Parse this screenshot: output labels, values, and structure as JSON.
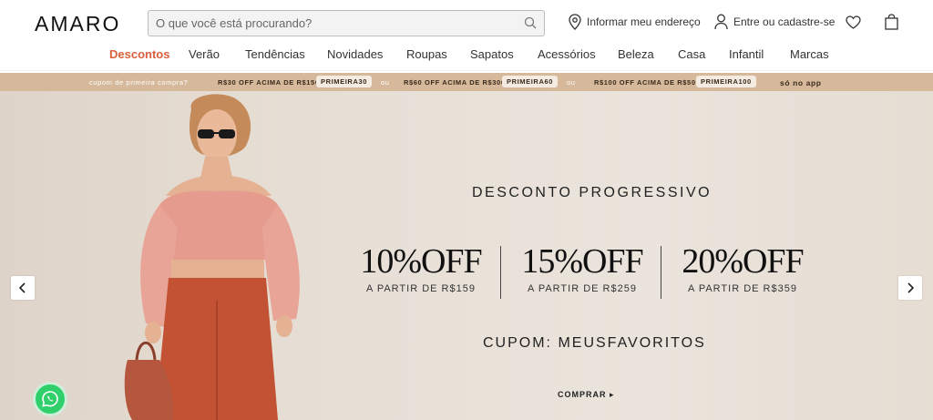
{
  "header": {
    "logo": "AMARO",
    "search_placeholder": "O que você está procurando?",
    "address_link": "Informar meu endereço",
    "account_link": "Entre ou cadastre-se"
  },
  "nav": {
    "items": [
      "Descontos",
      "Verão",
      "Tendências",
      "Novidades",
      "Roupas",
      "Sapatos",
      "Acessórios",
      "Beleza",
      "Casa",
      "Infantil",
      "Marcas"
    ],
    "active_color": "#d9603b"
  },
  "promo": {
    "intro": "cupom de primeira compra?",
    "offers": [
      {
        "text": "R$30 OFF ACIMA DE R$150",
        "code": "PRIMEIRA30"
      },
      {
        "text": "R$60 OFF ACIMA DE R$300",
        "code": "PRIMEIRA60"
      },
      {
        "text": "R$100 OFF ACIMA DE R$500",
        "code": "PRIMEIRA100"
      }
    ],
    "separator": "ou",
    "app_only": "só no app",
    "bg_color": "#d6b89a"
  },
  "banner": {
    "title": "DESCONTO PROGRESSIVO",
    "offers": [
      {
        "big": "10%OFF",
        "small": "A PARTIR DE R$159"
      },
      {
        "big": "15%OFF",
        "small": "A PARTIR DE R$259"
      },
      {
        "big": "20%OFF",
        "small": "A PARTIR DE R$359"
      }
    ],
    "coupon": "CUPOM: MEUSFAVORITOS",
    "cta": "COMPRAR ▸"
  },
  "icons": [
    "location-pin-icon",
    "user-icon",
    "heart-icon",
    "shopping-bag-icon",
    "search-icon",
    "chevron-left-icon",
    "chevron-right-icon",
    "whatsapp-icon"
  ]
}
